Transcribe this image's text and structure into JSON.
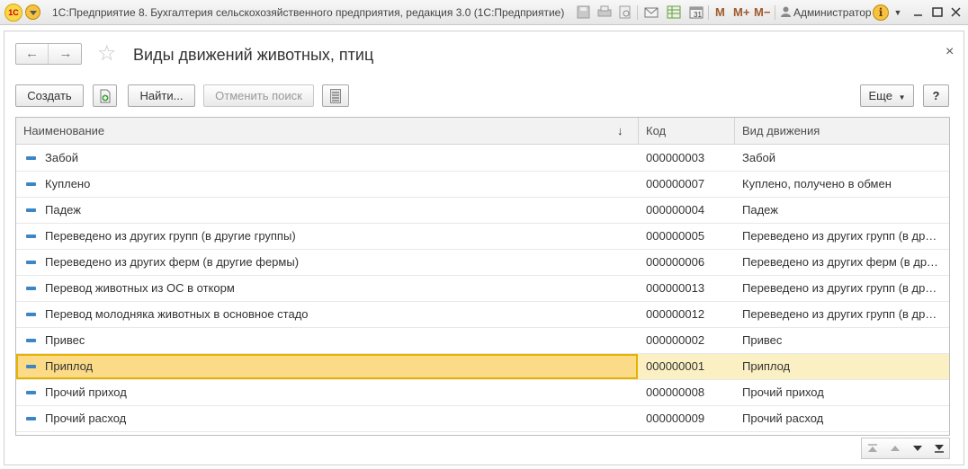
{
  "window": {
    "logo_text": "1С",
    "app_title": "1С:Предприятие 8. Бухгалтерия сельскохозяйственного предприятия, редакция 3.0  (1С:Предприятие)",
    "m_labels": [
      "M",
      "M+",
      "M−"
    ],
    "user": "Администратор",
    "info_label": "i"
  },
  "form": {
    "title": "Виды движений животных, птиц",
    "back_glyph": "←",
    "forward_glyph": "→",
    "close_glyph": "×"
  },
  "toolbar": {
    "create_label": "Создать",
    "find_label": "Найти...",
    "cancel_search_label": "Отменить поиск",
    "more_label": "Еще",
    "help_label": "?"
  },
  "table": {
    "columns": [
      "Наименование",
      "Код",
      "Вид движения"
    ],
    "sort_indicator": "↓",
    "rows": [
      {
        "name": "Забой",
        "code": "000000003",
        "kind": "Забой",
        "selected": false
      },
      {
        "name": "Куплено",
        "code": "000000007",
        "kind": "Куплено, получено в обмен",
        "selected": false
      },
      {
        "name": "Падеж",
        "code": "000000004",
        "kind": "Падеж",
        "selected": false
      },
      {
        "name": "Переведено из других групп (в другие группы)",
        "code": "000000005",
        "kind": "Переведено из других групп (в другие группы)",
        "selected": false
      },
      {
        "name": "Переведено из других ферм (в другие фермы)",
        "code": "000000006",
        "kind": "Переведено из других ферм (в другие фермы)",
        "selected": false
      },
      {
        "name": "Перевод животных из ОС в откорм",
        "code": "000000013",
        "kind": "Переведено из других групп (в другие группы)",
        "selected": false
      },
      {
        "name": "Перевод молодняка животных в основное стадо",
        "code": "000000012",
        "kind": "Переведено из других групп (в другие группы)",
        "selected": false
      },
      {
        "name": "Привес",
        "code": "000000002",
        "kind": "Привес",
        "selected": false
      },
      {
        "name": "Приплод",
        "code": "000000001",
        "kind": "Приплод",
        "selected": true
      },
      {
        "name": "Прочий приход",
        "code": "000000008",
        "kind": "Прочий приход",
        "selected": false
      },
      {
        "name": "Прочий расход",
        "code": "000000009",
        "kind": "Прочий расход",
        "selected": false
      }
    ]
  },
  "colors": {
    "selected_cell": "#fbdb87",
    "selected_row": "#fbf0c3",
    "selection_border": "#e6b200",
    "row_icon": "#3d86c6"
  }
}
